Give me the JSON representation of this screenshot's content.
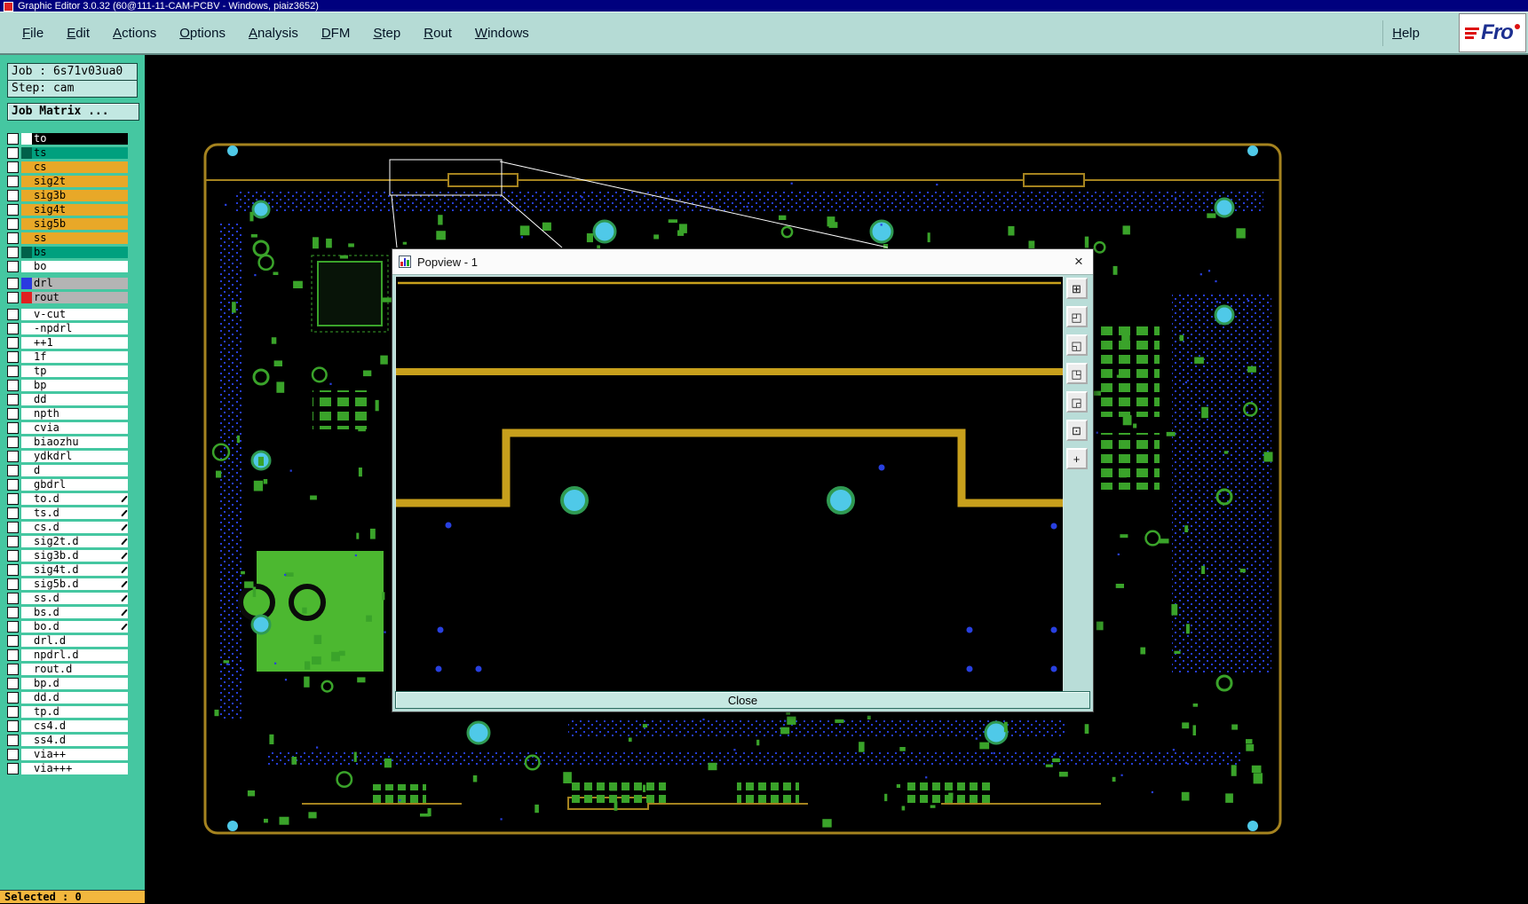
{
  "window": {
    "title": "Graphic Editor 3.0.32 (60@111-11-CAM-PCBV - Windows, piaiz3652)"
  },
  "menubar": {
    "items": [
      {
        "label": "File"
      },
      {
        "label": "Edit"
      },
      {
        "label": "Actions"
      },
      {
        "label": "Options"
      },
      {
        "label": "Analysis"
      },
      {
        "label": "DFM"
      },
      {
        "label": "Step"
      },
      {
        "label": "Rout"
      },
      {
        "label": "Windows"
      }
    ],
    "help_label": "Help",
    "logo_text": "Fro"
  },
  "sidebar": {
    "job_label": "Job : 6s71v03ua0",
    "step_label": "Step: cam",
    "job_matrix_label": "Job Matrix ...",
    "selected_label": "Selected : 0",
    "layers": [
      {
        "name": "to",
        "bg": "#000000",
        "fg": "#ffffff",
        "sw": "#ffffff"
      },
      {
        "name": "ts",
        "bg": "#00a07e",
        "sw": "#00614a"
      },
      {
        "name": "cs",
        "bg": "#e8a828",
        "sw": "#e8a828"
      },
      {
        "name": "sig2t",
        "bg": "#e8a828",
        "sw": "#e8a828"
      },
      {
        "name": "sig3b",
        "bg": "#e8a828",
        "sw": "#e8a828"
      },
      {
        "name": "sig4t",
        "bg": "#e8a828",
        "sw": "#e8a828"
      },
      {
        "name": "sig5b",
        "bg": "#e8a828",
        "sw": "#e8a828"
      },
      {
        "name": "ss",
        "bg": "#e8a828",
        "sw": "#e8a828"
      },
      {
        "name": "bs",
        "bg": "#00a07e",
        "sw": "#00614a"
      },
      {
        "name": "bo"
      },
      {
        "name": "drl",
        "bg": "#b4b4b4",
        "sw": "#2a3ae0",
        "gap": true
      },
      {
        "name": "rout",
        "bg": "#b4b4b4",
        "sw": "#e02020"
      },
      {
        "name": "v-cut",
        "gap": true
      },
      {
        "name": "-npdrl"
      },
      {
        "name": "++1"
      },
      {
        "name": "1f"
      },
      {
        "name": "tp"
      },
      {
        "name": "bp"
      },
      {
        "name": "dd"
      },
      {
        "name": "npth"
      },
      {
        "name": "cvia"
      },
      {
        "name": "biaozhu"
      },
      {
        "name": "ydkdrl"
      },
      {
        "name": "d"
      },
      {
        "name": "gbdrl"
      },
      {
        "name": "to.d",
        "flag": true
      },
      {
        "name": "ts.d",
        "flag": true
      },
      {
        "name": "cs.d",
        "flag": true
      },
      {
        "name": "sig2t.d",
        "flag": true
      },
      {
        "name": "sig3b.d",
        "flag": true
      },
      {
        "name": "sig4t.d",
        "flag": true
      },
      {
        "name": "sig5b.d",
        "flag": true
      },
      {
        "name": "ss.d",
        "flag": true
      },
      {
        "name": "bs.d",
        "flag": true
      },
      {
        "name": "bo.d",
        "flag": true
      },
      {
        "name": "drl.d"
      },
      {
        "name": "npdrl.d"
      },
      {
        "name": "rout.d"
      },
      {
        "name": "bp.d"
      },
      {
        "name": "dd.d"
      },
      {
        "name": "tp.d"
      },
      {
        "name": "cs4.d"
      },
      {
        "name": "ss4.d"
      },
      {
        "name": "via++"
      },
      {
        "name": "via+++"
      }
    ]
  },
  "popview": {
    "title": "Popview - 1",
    "close_x": "×",
    "close_label": "Close",
    "tools": [
      {
        "name": "zoom-window",
        "glyph": "⊞"
      },
      {
        "name": "view-top",
        "glyph": "◰"
      },
      {
        "name": "view-bottom",
        "glyph": "◱"
      },
      {
        "name": "view-left",
        "glyph": "◳"
      },
      {
        "name": "view-right",
        "glyph": "◲"
      },
      {
        "name": "fit-view",
        "glyph": "⊡"
      },
      {
        "name": "center-view",
        "glyph": "+"
      }
    ]
  },
  "colors": {
    "pcb_green": "#3aa32a",
    "pcb_green_bright": "#4cb830",
    "cyan": "#4fc9e8",
    "blue_dot": "#2840e0",
    "trace_yellow": "#c8a01c",
    "board_olive": "#a5831f",
    "sidebar_teal": "#45c7a1",
    "orange_layer": "#e8a828",
    "teal_layer": "#00a07e",
    "selected_orange": "#f2b73e"
  }
}
